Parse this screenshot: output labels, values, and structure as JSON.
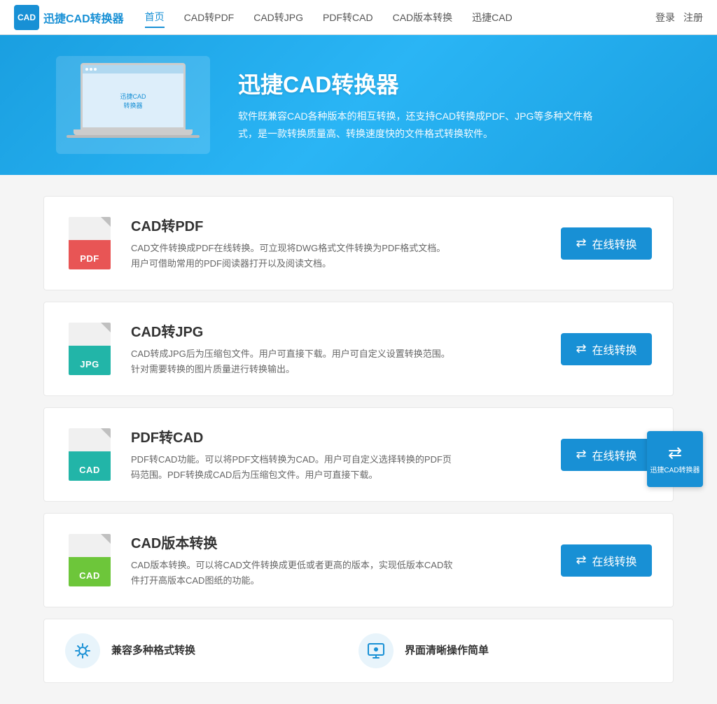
{
  "nav": {
    "logo_icon": "CAD",
    "logo_text": "迅捷CAD转换器",
    "links": [
      {
        "label": "首页",
        "active": true
      },
      {
        "label": "CAD转PDF",
        "active": false
      },
      {
        "label": "CAD转JPG",
        "active": false
      },
      {
        "label": "PDF转CAD",
        "active": false
      },
      {
        "label": "CAD版本转换",
        "active": false
      },
      {
        "label": "迅捷CAD",
        "active": false
      }
    ],
    "login": "登录",
    "register": "注册"
  },
  "hero": {
    "title": "迅捷CAD转换器",
    "desc": "软件既兼容CAD各种版本的相互转换，还支持CAD转换成PDF、JPG等多种文件格式，是一款转换质量高、转换速度快的文件格式转换软件。"
  },
  "conversions": [
    {
      "id": "cad-to-pdf",
      "title": "CAD转PDF",
      "desc": "CAD文件转换成PDF在线转换。可立现将DWG格式文件转换为PDF格式文档。用户可借助常用的PDF阅读器打开以及阅读文档。",
      "btn_label": "在线转换",
      "icon_type": "pdf",
      "icon_text": "PDF"
    },
    {
      "id": "cad-to-jpg",
      "title": "CAD转JPG",
      "desc": "CAD转成JPG后为压缩包文件。用户可直接下载。用户可自定义设置转换范围。针对需要转换的图片质量进行转换输出。",
      "btn_label": "在线转换",
      "icon_type": "jpg",
      "icon_text": "JPG"
    },
    {
      "id": "pdf-to-cad",
      "title": "PDF转CAD",
      "desc": "PDF转CAD功能。可以将PDF文档转换为CAD。用户可自定义选择转换的PDF页码范围。PDF转换成CAD后为压缩包文件。用户可直接下载。",
      "btn_label": "在线转换",
      "icon_type": "cad-from-pdf",
      "icon_text": "CAD"
    },
    {
      "id": "cad-version",
      "title": "CAD版本转换",
      "desc": "CAD版本转换。可以将CAD文件转换成更低或者更高的版本，实现低版本CAD软件打开高版本CAD图纸的功能。",
      "btn_label": "在线转换",
      "icon_type": "cad-version",
      "icon_text": "CAD"
    }
  ],
  "features": [
    {
      "id": "multi-format",
      "icon": "⚙",
      "title": "兼容多种格式转换",
      "desc": ""
    },
    {
      "id": "simple-ui",
      "icon": "🖥",
      "title": "界面清晰操作简单",
      "desc": ""
    }
  ],
  "float_btn": {
    "label": "迅捷CAD转换器",
    "icon": "⇄"
  }
}
